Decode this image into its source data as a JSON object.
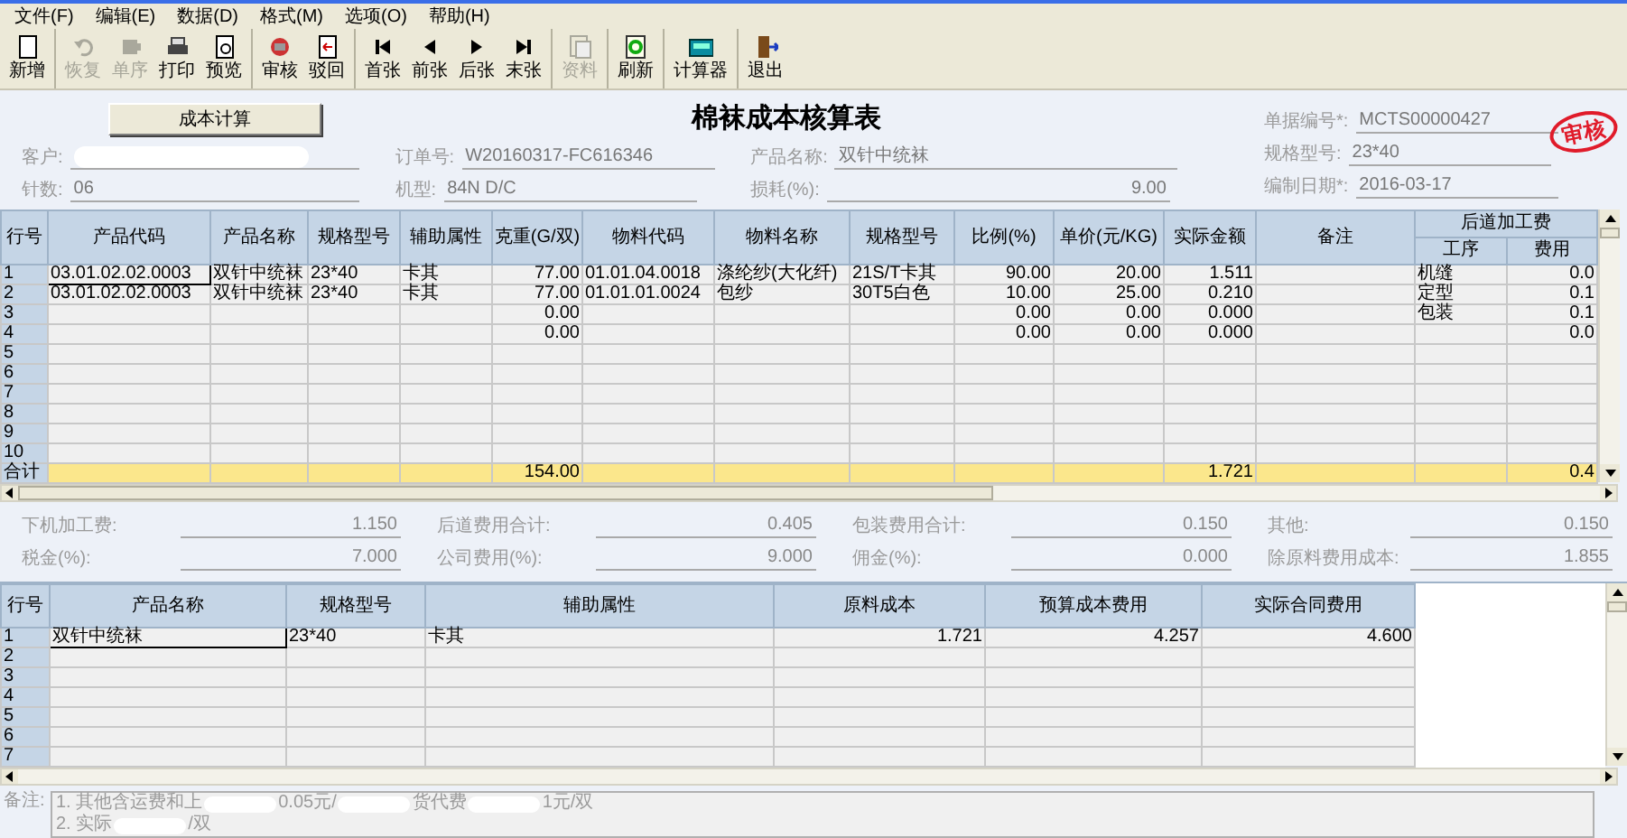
{
  "menu": [
    "文件(F)",
    "编辑(E)",
    "数据(D)",
    "格式(M)",
    "选项(O)",
    "帮助(H)"
  ],
  "toolbar": [
    [
      {
        "label": "新增",
        "disabled": false
      }
    ],
    [
      {
        "label": "恢复",
        "disabled": true
      },
      {
        "label": "单序",
        "disabled": true
      },
      {
        "label": "打印",
        "disabled": false
      },
      {
        "label": "预览",
        "disabled": false
      }
    ],
    [
      {
        "label": "审核",
        "disabled": false
      },
      {
        "label": "驳回",
        "disabled": false
      }
    ],
    [
      {
        "label": "首张",
        "disabled": false
      },
      {
        "label": "前张",
        "disabled": false
      },
      {
        "label": "后张",
        "disabled": false
      },
      {
        "label": "末张",
        "disabled": false
      }
    ],
    [
      {
        "label": "资料",
        "disabled": true
      }
    ],
    [
      {
        "label": "刷新",
        "disabled": false
      }
    ],
    [
      {
        "label": "计算器",
        "disabled": false
      }
    ],
    [
      {
        "label": "退出",
        "disabled": false
      }
    ]
  ],
  "calc_button": "成本计算",
  "title": "棉袜成本核算表",
  "stamp": "审核",
  "form_columns": [
    [
      {
        "label": "客户:",
        "redacted": true,
        "kind": "text"
      },
      {
        "label": "针数:",
        "value": "06",
        "kind": "text"
      }
    ],
    [
      {
        "label": "订单号:",
        "value": "W20160317-FC616346",
        "kind": "text"
      },
      {
        "label": "机型:",
        "value": "84N D/C",
        "kind": "text"
      }
    ],
    [
      {
        "label": "产品名称:",
        "value": "双针中统袜",
        "kind": "text"
      },
      {
        "label": "损耗(%):",
        "value": "9.00",
        "kind": "number"
      }
    ],
    [
      {
        "label": "单据编号*:",
        "value": "MCTS00000427",
        "kind": "text"
      },
      {
        "label": "规格型号:",
        "value": "23*40",
        "kind": "text"
      },
      {
        "label": "编制日期*:",
        "value": "2016-03-17",
        "kind": "text"
      }
    ]
  ],
  "material_table": {
    "columns": [
      "行号",
      "产品代码",
      "产品名称",
      "规格型号",
      "辅助属性",
      "克重(G/双)",
      "物料代码",
      "物料名称",
      "规格型号",
      "比例(%)",
      "单价(元/KG)",
      "实际金额",
      "备注",
      "工序",
      "费用"
    ],
    "group_header": "后道加工费",
    "rows": [
      {
        "selected": true,
        "row": "1",
        "product_code": "03.01.02.02.0003",
        "product_name": "双针中统袜",
        "spec": "23*40",
        "attribute": "卡其",
        "weight": "77.00",
        "material_code": "01.01.04.0018",
        "material_name": "涤纶纱(大化纤)",
        "material_spec": "21S/T卡其",
        "ratio": "90.00",
        "unit_price": "20.00",
        "amount": "1.511",
        "process": "机缝",
        "fee": "0.0"
      },
      {
        "selected": false,
        "row": "2",
        "product_code": "03.01.02.02.0003",
        "product_name": "双针中统袜",
        "spec": "23*40",
        "attribute": "卡其",
        "weight": "77.00",
        "material_code": "01.01.01.0024",
        "material_name": "包纱",
        "material_spec": "30T5白色",
        "ratio": "10.00",
        "unit_price": "25.00",
        "amount": "0.210",
        "process": "定型",
        "fee": "0.1"
      },
      {
        "selected": false,
        "row": "3",
        "weight": "0.00",
        "ratio": "0.00",
        "unit_price": "0.00",
        "amount": "0.000",
        "process": "包装",
        "fee": "0.1"
      },
      {
        "selected": false,
        "row": "4",
        "weight": "0.00",
        "ratio": "0.00",
        "unit_price": "0.00",
        "amount": "0.000",
        "fee": "0.0"
      },
      {
        "selected": false,
        "row": "5"
      },
      {
        "selected": false,
        "row": "6"
      },
      {
        "selected": false,
        "row": "7"
      },
      {
        "selected": false,
        "row": "8"
      },
      {
        "selected": false,
        "row": "9"
      },
      {
        "selected": false,
        "row": "10"
      }
    ],
    "total": {
      "row": "合计",
      "weight": "154.00",
      "amount": "1.721",
      "fee": "0.4"
    }
  },
  "summary_fields": [
    {
      "label": "下机加工费:",
      "value": "1.150"
    },
    {
      "label": "后道费用合计:",
      "value": "0.405"
    },
    {
      "label": "包装费用合计:",
      "value": "0.150"
    },
    {
      "label": "其他:",
      "value": "0.150"
    },
    {
      "label": "税金(%):",
      "value": "7.000"
    },
    {
      "label": "公司费用(%):",
      "value": "9.000"
    },
    {
      "label": "佣金(%):",
      "value": "0.000"
    },
    {
      "label": "除原料费用成本:",
      "value": "1.855"
    }
  ],
  "product_table": {
    "columns": [
      "行号",
      "产品名称",
      "规格型号",
      "辅助属性",
      "原料成本",
      "预算成本费用",
      "实际合同费用"
    ],
    "rows": [
      {
        "selected": true,
        "row": "1",
        "product_name": "双针中统袜",
        "spec": "23*40",
        "attribute": "卡其",
        "material_cost": "1.721",
        "budget_cost": "4.257",
        "contract_cost": "4.600"
      },
      {
        "selected": false,
        "row": "2"
      },
      {
        "selected": false,
        "row": "3"
      },
      {
        "selected": false,
        "row": "4"
      },
      {
        "selected": false,
        "row": "5"
      },
      {
        "selected": false,
        "row": "6"
      },
      {
        "selected": false,
        "row": "7"
      }
    ]
  },
  "notes": {
    "label": "备注:",
    "lines": [
      [
        "1. 其他含运费和上",
        "0.05元/",
        "货代费",
        "1元/双"
      ],
      [
        "2. 实际",
        "/双"
      ]
    ]
  }
}
